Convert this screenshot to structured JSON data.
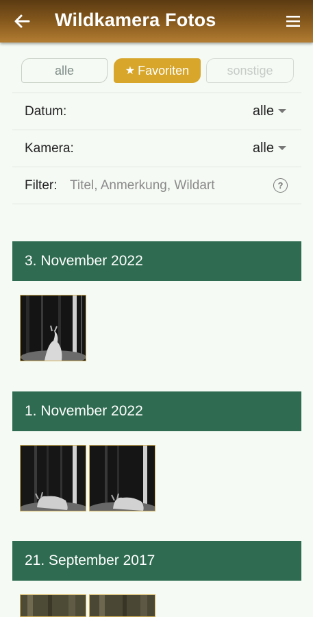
{
  "appbar": {
    "title": "Wildkamera Fotos",
    "back_icon": "arrow-left-icon",
    "menu_icon": "hamburger-menu-icon"
  },
  "segments": [
    {
      "label": "alle",
      "state": "unselected"
    },
    {
      "label": "Favoriten",
      "state": "selected",
      "icon": "star-icon"
    },
    {
      "label": "sonstige",
      "state": "disabled"
    }
  ],
  "filters": {
    "date_label": "Datum:",
    "date_value": "alle",
    "camera_label": "Kamera:",
    "camera_value": "alle",
    "filter_label": "Filter:",
    "filter_placeholder": "Titel, Anmerkung, Wildart"
  },
  "groups": [
    {
      "date": "3. November 2022",
      "photos": [
        "night-deer-photo"
      ]
    },
    {
      "date": "1. November 2022",
      "photos": [
        "night-deer-photo",
        "night-deer-photo"
      ]
    },
    {
      "date": "21. September 2017",
      "photos": [
        "day-forest-photo",
        "day-forest-photo"
      ]
    }
  ],
  "colors": {
    "appbar": "#8a5c1e",
    "accent": "#d7a62b",
    "section_header": "#2e6b50",
    "background": "#f5faf4"
  }
}
